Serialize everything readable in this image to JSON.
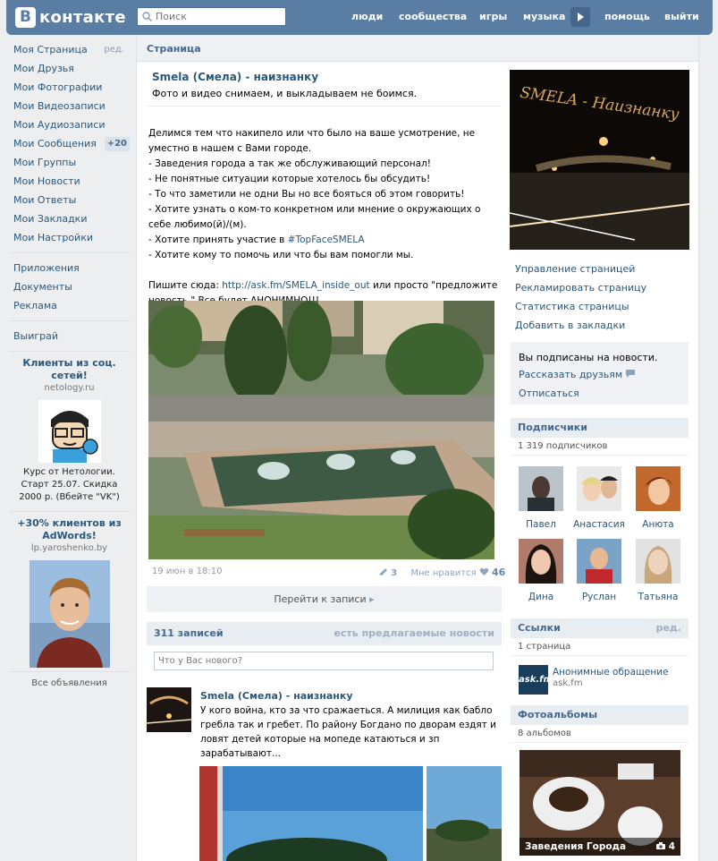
{
  "header": {
    "logo_letter": "В",
    "logo_text": "контакте",
    "search_placeholder": "Поиск",
    "nav": [
      "люди",
      "сообщества",
      "игры",
      "музыка",
      "помощь",
      "выйти"
    ]
  },
  "left_menu": {
    "items": [
      {
        "label": "Моя Страница",
        "edit": "ред."
      },
      {
        "label": "Мои Друзья"
      },
      {
        "label": "Мои Фотографии"
      },
      {
        "label": "Мои Видеозаписи"
      },
      {
        "label": "Мои Аудиозаписи"
      },
      {
        "label": "Мои Сообщения",
        "badge": "+20"
      },
      {
        "label": "Мои Группы"
      },
      {
        "label": "Мои Новости"
      },
      {
        "label": "Мои Ответы"
      },
      {
        "label": "Мои Закладки"
      },
      {
        "label": "Мои Настройки"
      }
    ],
    "extra": [
      "Приложения",
      "Документы",
      "Реклама"
    ],
    "game": "Выиграй",
    "ads": [
      {
        "title": "Клиенты из соц. сетей!",
        "domain": "netology.ru",
        "text": "Курс от Нетологии. Старт 25.07. Скидка 2000 р. (Вбейте \"VK\")"
      },
      {
        "title": "+30% клиентов из AdWords!",
        "domain": "lp.yaroshenko.by"
      }
    ],
    "all_ads": "Все объявления"
  },
  "page": {
    "head": "Страница",
    "group_name": "Smela (Смела) - наизнанку",
    "status": "Фото и видео снимаем, и выкладываем не боимся.",
    "description": "Делимся тем что накипело или что было на ваше усмотрение, не уместно в нашем с Вами городе.\n- Заведения города а так же обслуживающий персонал!\n- Не понятные ситуации которые хотелось бы обсудить!\n- То что заметили не одни Вы но все бояться об этом говорить!\n- Хотите узнать о ком-то конкретном или мнение о окружающих о себе любимо(й)/(м).",
    "desc_tag_line_prefix": "- Хотите принять участие в ",
    "desc_tag": "#TopFaceSMELA",
    "desc_last": "- Хотите кому то помочь или что бы вам помогли мы.",
    "write_prefix": "Пишите сюда: ",
    "write_link": "http://ask.fm/SMELA_inside_out",
    "write_suffix": " или просто \"предложите новость.\" Все будет АНОНИМНО!!!",
    "post_date": "19 июн в 18:10",
    "reposts": "3",
    "like_label": "Мне нравится",
    "likes": "46",
    "goto": "Перейти к записи",
    "wall_count": "311 записей",
    "suggested": "есть предлагаемые новости",
    "new_post_placeholder": "Что у Вас нового?",
    "post2_name": "Smela (Смела) - наизнанку",
    "post2_text": "У кого война, кто за что сражаеться. А милиция как бабло гребла так и гребет. По району Богдано по дворам ездят и ловят детей которые на мопеде катаються и зп зарабатывают..."
  },
  "right": {
    "cover_text": "SMELA - Наизнанку",
    "actions": [
      "Управление страницей",
      "Рекламировать страницу",
      "Статистика страницы",
      "Добавить в закладки"
    ],
    "subscribed": "Вы подписаны на новости.",
    "tell_friends": "Рассказать друзьям",
    "unsubscribe": "Отписаться",
    "subscribers_head": "Подписчики",
    "subscribers_count": "1 319 подписчиков",
    "subscribers": [
      "Павел",
      "Анастасия",
      "Анюта",
      "Дина",
      "Руслан",
      "Татьяна"
    ],
    "links_head": "Ссылки",
    "links_edit": "ред.",
    "links_count": "1 страница",
    "link_title": "Анонимные обращение",
    "link_domain": "ask.fm",
    "link_logo": "ask.fm",
    "albums_head": "Фотоальбомы",
    "albums_count": "8 альбомов",
    "album_name": "Заведения Города",
    "album_photos": "4"
  }
}
